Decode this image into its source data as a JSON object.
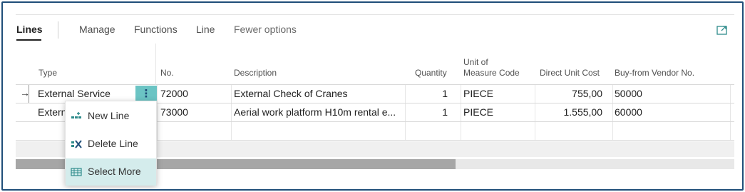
{
  "toolbar": {
    "tabs": [
      "Lines",
      "Manage",
      "Functions",
      "Line",
      "Fewer options"
    ]
  },
  "grid": {
    "columns": [
      "Type",
      "No.",
      "Description",
      "Quantity",
      "Unit of Measure Code",
      "Direct Unit Cost",
      "Buy-from Vendor No."
    ],
    "columns_display": {
      "type": "Type",
      "no": "No.",
      "description": "Description",
      "quantity": "Quantity",
      "uom_line1": "Unit of",
      "uom_line2": "Measure Code",
      "unit_cost": "Direct Unit Cost",
      "vendor": "Buy-from Vendor No."
    },
    "rows": [
      {
        "type": "External Service",
        "no": "72000",
        "description": "External Check of Cranes",
        "quantity": "1",
        "uom": "PIECE",
        "unit_cost": "755,00",
        "vendor": "50000"
      },
      {
        "type": "Extern",
        "no": "73000",
        "description": "Aerial work platform H10m rental e...",
        "quantity": "1",
        "uom": "PIECE",
        "unit_cost": "1.555,00",
        "vendor": "60000"
      }
    ],
    "current_row_indicator": "→",
    "row_menu_glyph": "⋮"
  },
  "context_menu": {
    "items": [
      {
        "label": "New Line",
        "icon": "new-line-icon"
      },
      {
        "label": "Delete Line",
        "icon": "delete-line-icon"
      },
      {
        "label": "Select More",
        "icon": "select-more-icon",
        "selected": true
      }
    ]
  },
  "colors": {
    "frame": "#1f4e79",
    "accent": "#6bc4c4",
    "selected_bg": "#d4ecec",
    "icon": "#2e8b8b"
  }
}
